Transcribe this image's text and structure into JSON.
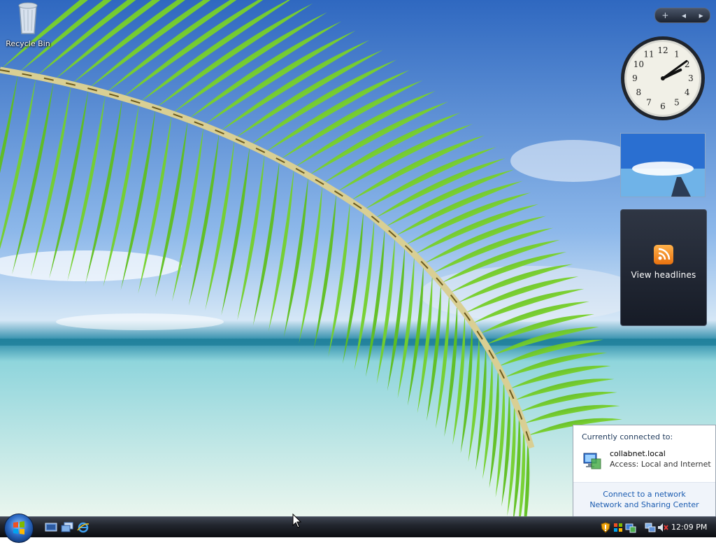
{
  "desktop": {
    "icons": [
      {
        "label": "Recycle Bin",
        "icon": "recycle-bin-icon"
      }
    ]
  },
  "sidebar": {
    "controls": {
      "add": "+",
      "prev": "◂",
      "next": "▸"
    },
    "clock": {
      "hour": 2,
      "minute": 9,
      "numbers": [
        "12",
        "1",
        "2",
        "3",
        "4",
        "5",
        "6",
        "7",
        "8",
        "9",
        "10",
        "11"
      ]
    },
    "feed": {
      "label": "View headlines",
      "icon": "rss-icon"
    }
  },
  "network_popup": {
    "heading": "Currently connected to:",
    "connection": {
      "name": "collabnet.local",
      "access": "Access:  Local and Internet",
      "icon": "network-computer-icon"
    },
    "links": [
      "Connect to a network",
      "Network and Sharing Center"
    ]
  },
  "taskbar": {
    "start_icon": "windows-logo-icon",
    "quick_launch": [
      "show-desktop-icon",
      "switch-windows-icon",
      "internet-explorer-icon"
    ],
    "tray_icons": [
      "security-shield-icon",
      "windows-update-icon",
      "network-icon",
      "network-connections-icon",
      "speaker-muted-icon"
    ],
    "clock": "12:09 PM"
  },
  "colors": {
    "taskbar": "#22262e",
    "link": "#1a5bb0",
    "popup_footer": "#f0f4fa",
    "leaf": "#6cc521"
  }
}
